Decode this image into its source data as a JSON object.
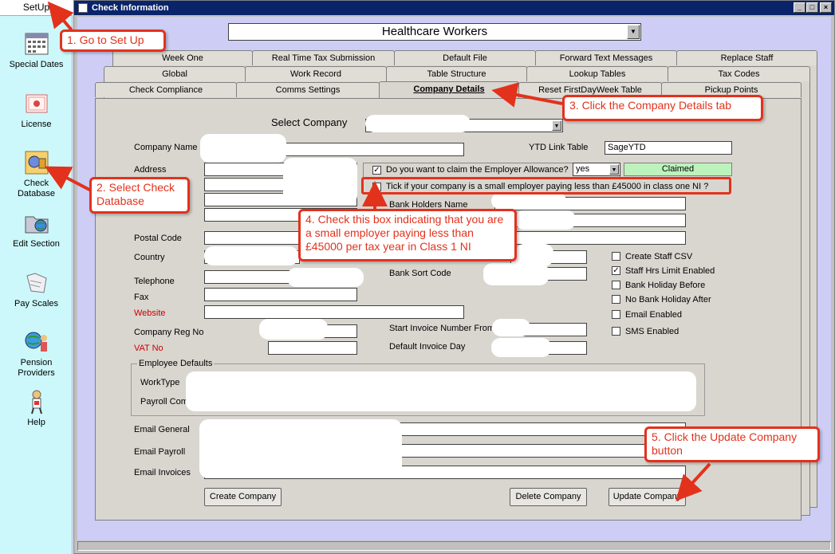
{
  "sidebar": {
    "setup_label": "SetUp",
    "items": [
      {
        "label": "Special Dates",
        "icon": "calendar-icon"
      },
      {
        "label": "License",
        "icon": "certificate-icon"
      },
      {
        "label": "Check Database",
        "icon": "database-icon"
      },
      {
        "label": "Edit Section",
        "icon": "folder-globe-icon"
      },
      {
        "label": "Pay Scales",
        "icon": "scales-icon"
      },
      {
        "label": "Pension Providers",
        "icon": "people-globe-icon"
      },
      {
        "label": "Help",
        "icon": "help-person-icon"
      }
    ]
  },
  "window": {
    "title": "Check Information",
    "minimize": "_",
    "maximize": "□",
    "close": "×"
  },
  "group_select": {
    "value": "Healthcare Workers"
  },
  "tabs": {
    "row1": [
      "Week One",
      "Real Time Tax Submission",
      "Default File",
      "Forward Text Messages",
      "Replace Staff"
    ],
    "row2": [
      "Global",
      "Work Record",
      "Table Structure",
      "Lookup Tables",
      "Tax Codes"
    ],
    "row3": [
      "Check Compliance",
      "Comms Settings",
      "Company Details",
      "Reset FirstDayWeek Table",
      "Pickup Points"
    ]
  },
  "form": {
    "select_company_label": "Select Company",
    "company_name_label": "Company Name",
    "address_label": "Address",
    "postal_code_label": "Postal Code",
    "country_label": "Country",
    "telephone_label": "Telephone",
    "fax_label": "Fax",
    "website_label": "Website",
    "company_reg_label": "Company Reg No",
    "vat_label": "VAT No",
    "ytd_label": "YTD Link Table",
    "ytd_value": "SageYTD",
    "employer_allowance_question": "Do you want to claim the Employer Allowance?",
    "employer_allowance_value": "yes",
    "claimed_status": "Claimed",
    "small_employer_question": "Tick if your company is a small employer paying less than £45000  in class one NI ?",
    "bank_holders_label": "Bank Holders Name",
    "bank_sort_label": "Bank Sort Code",
    "start_invoice_label": "Start Invoice Number From",
    "default_invoice_label": "Default Invoice Day",
    "employee_defaults_title": "Employee Defaults",
    "worktype_label": "WorkType",
    "payroll_comp_label": "Payroll Comp",
    "email_general_label": "Email General",
    "email_payroll_label": "Email Payroll",
    "email_invoices_label": "Email Invoices",
    "options": [
      {
        "label": "Create Staff CSV",
        "checked": false
      },
      {
        "label": "Staff Hrs Limit Enabled",
        "checked": true
      },
      {
        "label": "Bank Holiday Before",
        "checked": false
      },
      {
        "label": "No Bank Holiday After",
        "checked": false
      },
      {
        "label": "Email Enabled",
        "checked": false
      },
      {
        "label": "SMS Enabled",
        "checked": false
      }
    ],
    "check_mark": "✓",
    "create_company_button": "Create Company",
    "delete_company_button": "Delete Company",
    "update_company_button": "Update Company"
  },
  "callouts": {
    "step1": "1. Go to Set Up",
    "step2": "2. Select Check Database",
    "step3": "3. Click the Company Details tab",
    "step4": "4. Check this box indicating that you are a small employer paying less than £45000 per tax year in Class 1 NI",
    "step5": "5. Click the Update Company button"
  },
  "colors": {
    "callout_red": "#e2321c",
    "title_bar": "#0a246a",
    "client_bg": "#cdcdf5",
    "sidebar_bg": "#ccf8fb",
    "claimed_bg": "#bdf2bd"
  }
}
